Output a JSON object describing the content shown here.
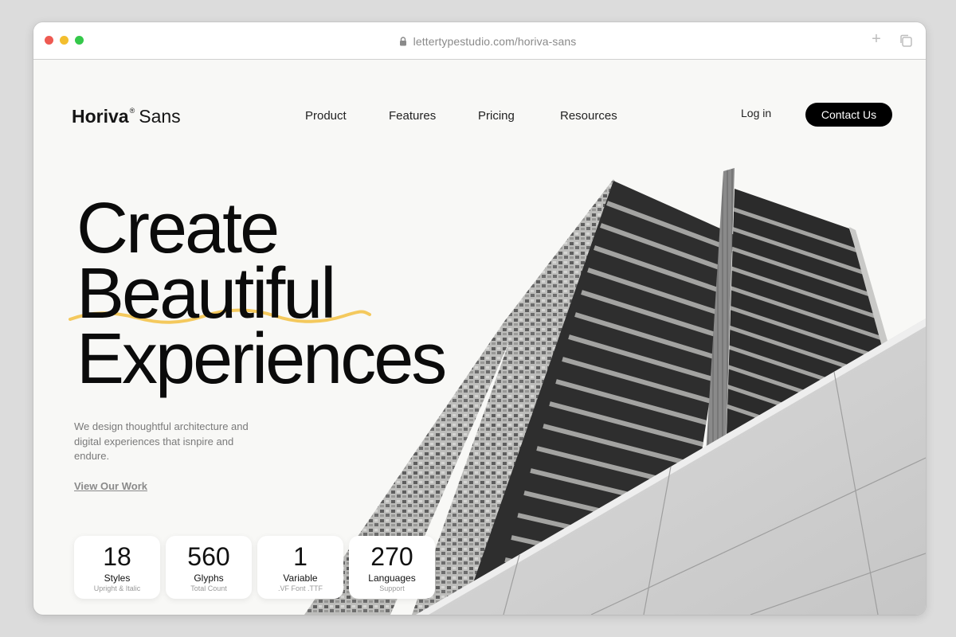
{
  "browser": {
    "url": "lettertypestudio.com/horiva-sans",
    "icons": [
      "lock-icon",
      "plus-icon",
      "copy-icon"
    ]
  },
  "brand": {
    "name_bold": "Horiva",
    "registered": "®",
    "name_light": "Sans"
  },
  "nav": {
    "items": [
      "Product",
      "Features",
      "Pricing",
      "Resources"
    ],
    "login": "Log in",
    "contact": "Contact Us"
  },
  "hero": {
    "lines": [
      "Create",
      "Beautiful",
      "Experiences"
    ],
    "description": "We design thoughtful architecture and digital experiences that isnpire and endure.",
    "cta": "View Our Work",
    "accent_color": "#f4c95d"
  },
  "stats": [
    {
      "value": "18",
      "label": "Styles",
      "sub": "Upright & Italic"
    },
    {
      "value": "560",
      "label": "Glyphs",
      "sub": "Total Count"
    },
    {
      "value": "1",
      "label": "Variable",
      "sub": ".VF Font .TTF"
    },
    {
      "value": "270",
      "label": "Languages",
      "sub": "Support"
    }
  ]
}
